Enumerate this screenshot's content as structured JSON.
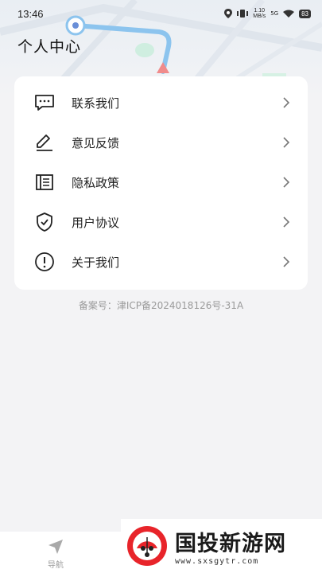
{
  "status_bar": {
    "time": "13:46",
    "net_speed_value": "1.10",
    "net_speed_unit": "MB/s",
    "signal": "5G",
    "battery": "83"
  },
  "header": {
    "title": "个人中心"
  },
  "menu": {
    "items": [
      {
        "label": "联系我们",
        "icon": "message-icon"
      },
      {
        "label": "意见反馈",
        "icon": "edit-icon"
      },
      {
        "label": "隐私政策",
        "icon": "document-icon"
      },
      {
        "label": "用户协议",
        "icon": "shield-check-icon"
      },
      {
        "label": "关于我们",
        "icon": "info-icon"
      }
    ]
  },
  "footer": {
    "beian": "备案号：津ICP备2024018126号-31A"
  },
  "bottom_nav": {
    "tabs": [
      {
        "label": "导航",
        "icon": "navigation-arrow-icon"
      }
    ]
  },
  "watermark": {
    "title": "国投新游网",
    "domain": "www.sxsgytr.com"
  },
  "colors": {
    "background": "#f3f3f5",
    "card": "#ffffff",
    "text": "#222222",
    "muted": "#9a9a9a",
    "map_route": "#7ab8e8"
  }
}
